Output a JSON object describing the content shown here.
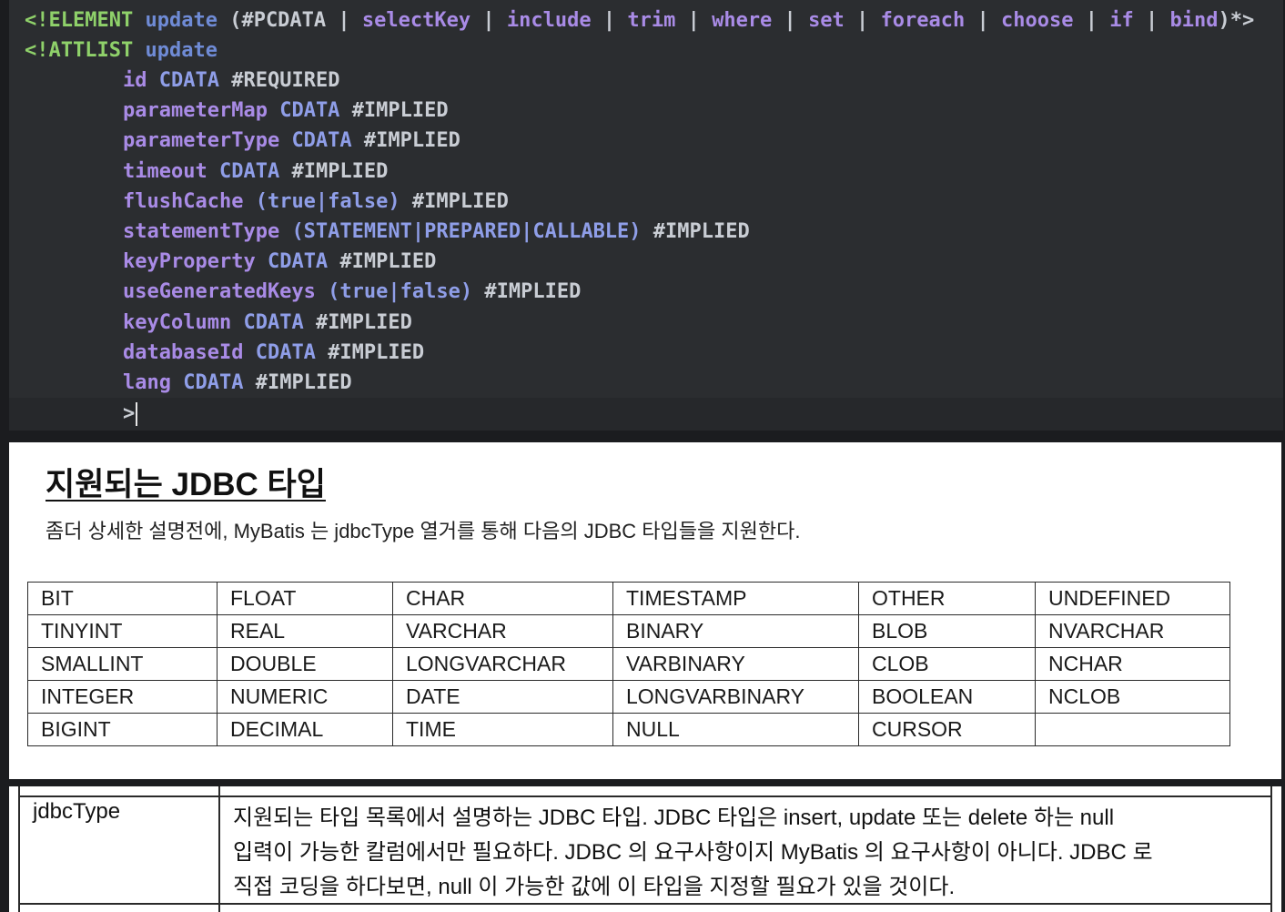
{
  "code": {
    "element_line": {
      "open": "<!ELEMENT",
      "name": "update",
      "content_open": "(#PCDATA | ",
      "children": [
        "selectKey",
        "include",
        "trim",
        "where",
        "set",
        "foreach",
        "choose",
        "if",
        "bind"
      ],
      "separator": " | ",
      "content_close": ")*>"
    },
    "attlist_line": {
      "open": "<!ATTLIST",
      "name": "update"
    },
    "attributes": [
      {
        "name": "id",
        "type": "CDATA",
        "default": "#REQUIRED"
      },
      {
        "name": "parameterMap",
        "type": "CDATA",
        "default": "#IMPLIED"
      },
      {
        "name": "parameterType",
        "type": "CDATA",
        "default": "#IMPLIED"
      },
      {
        "name": "timeout",
        "type": "CDATA",
        "default": "#IMPLIED"
      },
      {
        "name": "flushCache",
        "type": "(true|false)",
        "default": "#IMPLIED"
      },
      {
        "name": "statementType",
        "type": "(STATEMENT|PREPARED|CALLABLE)",
        "default": "#IMPLIED"
      },
      {
        "name": "keyProperty",
        "type": "CDATA",
        "default": "#IMPLIED"
      },
      {
        "name": "useGeneratedKeys",
        "type": "(true|false)",
        "default": "#IMPLIED"
      },
      {
        "name": "keyColumn",
        "type": "CDATA",
        "default": "#IMPLIED"
      },
      {
        "name": "databaseId",
        "type": "CDATA",
        "default": "#IMPLIED"
      },
      {
        "name": "lang",
        "type": "CDATA",
        "default": "#IMPLIED"
      }
    ],
    "closing": ">"
  },
  "doc": {
    "heading": "지원되는 JDBC 타입",
    "description": "좀더 상세한 설명전에, MyBatis 는 jdbcType 열거를 통해 다음의 JDBC 타입들을 지원한다.",
    "jdbc_types": [
      [
        "BIT",
        "FLOAT",
        "CHAR",
        "TIMESTAMP",
        "OTHER",
        "UNDEFINED"
      ],
      [
        "TINYINT",
        "REAL",
        "VARCHAR",
        "BINARY",
        "BLOB",
        "NVARCHAR"
      ],
      [
        "SMALLINT",
        "DOUBLE",
        "LONGVARCHAR",
        "VARBINARY",
        "CLOB",
        "NCHAR"
      ],
      [
        "INTEGER",
        "NUMERIC",
        "DATE",
        "LONGVARBINARY",
        "BOOLEAN",
        "NCLOB"
      ],
      [
        "BIGINT",
        "DECIMAL",
        "TIME",
        "NULL",
        "CURSOR",
        ""
      ]
    ]
  },
  "property_table": {
    "property": "jdbcType",
    "description_lines": [
      "지원되는 타입 목록에서 설명하는 JDBC 타입. JDBC 타입은 insert, update 또는 delete 하는 null",
      "입력이 가능한 칼럼에서만 필요하다. JDBC 의 요구사항이지 MyBatis 의 요구사항이 아니다. JDBC 로",
      "직접 코딩을 하다보면, null 이 가능한 값에 이 타입을 지정할 필요가 있을 것이다."
    ]
  },
  "colors": {
    "editor_bg": "#2b2d30",
    "keyword": "#8fd16a",
    "tag_name": "#6f8bd6",
    "attribute": "#a98be6",
    "type": "#8f9ee8",
    "document_bg": "#ffffff"
  }
}
